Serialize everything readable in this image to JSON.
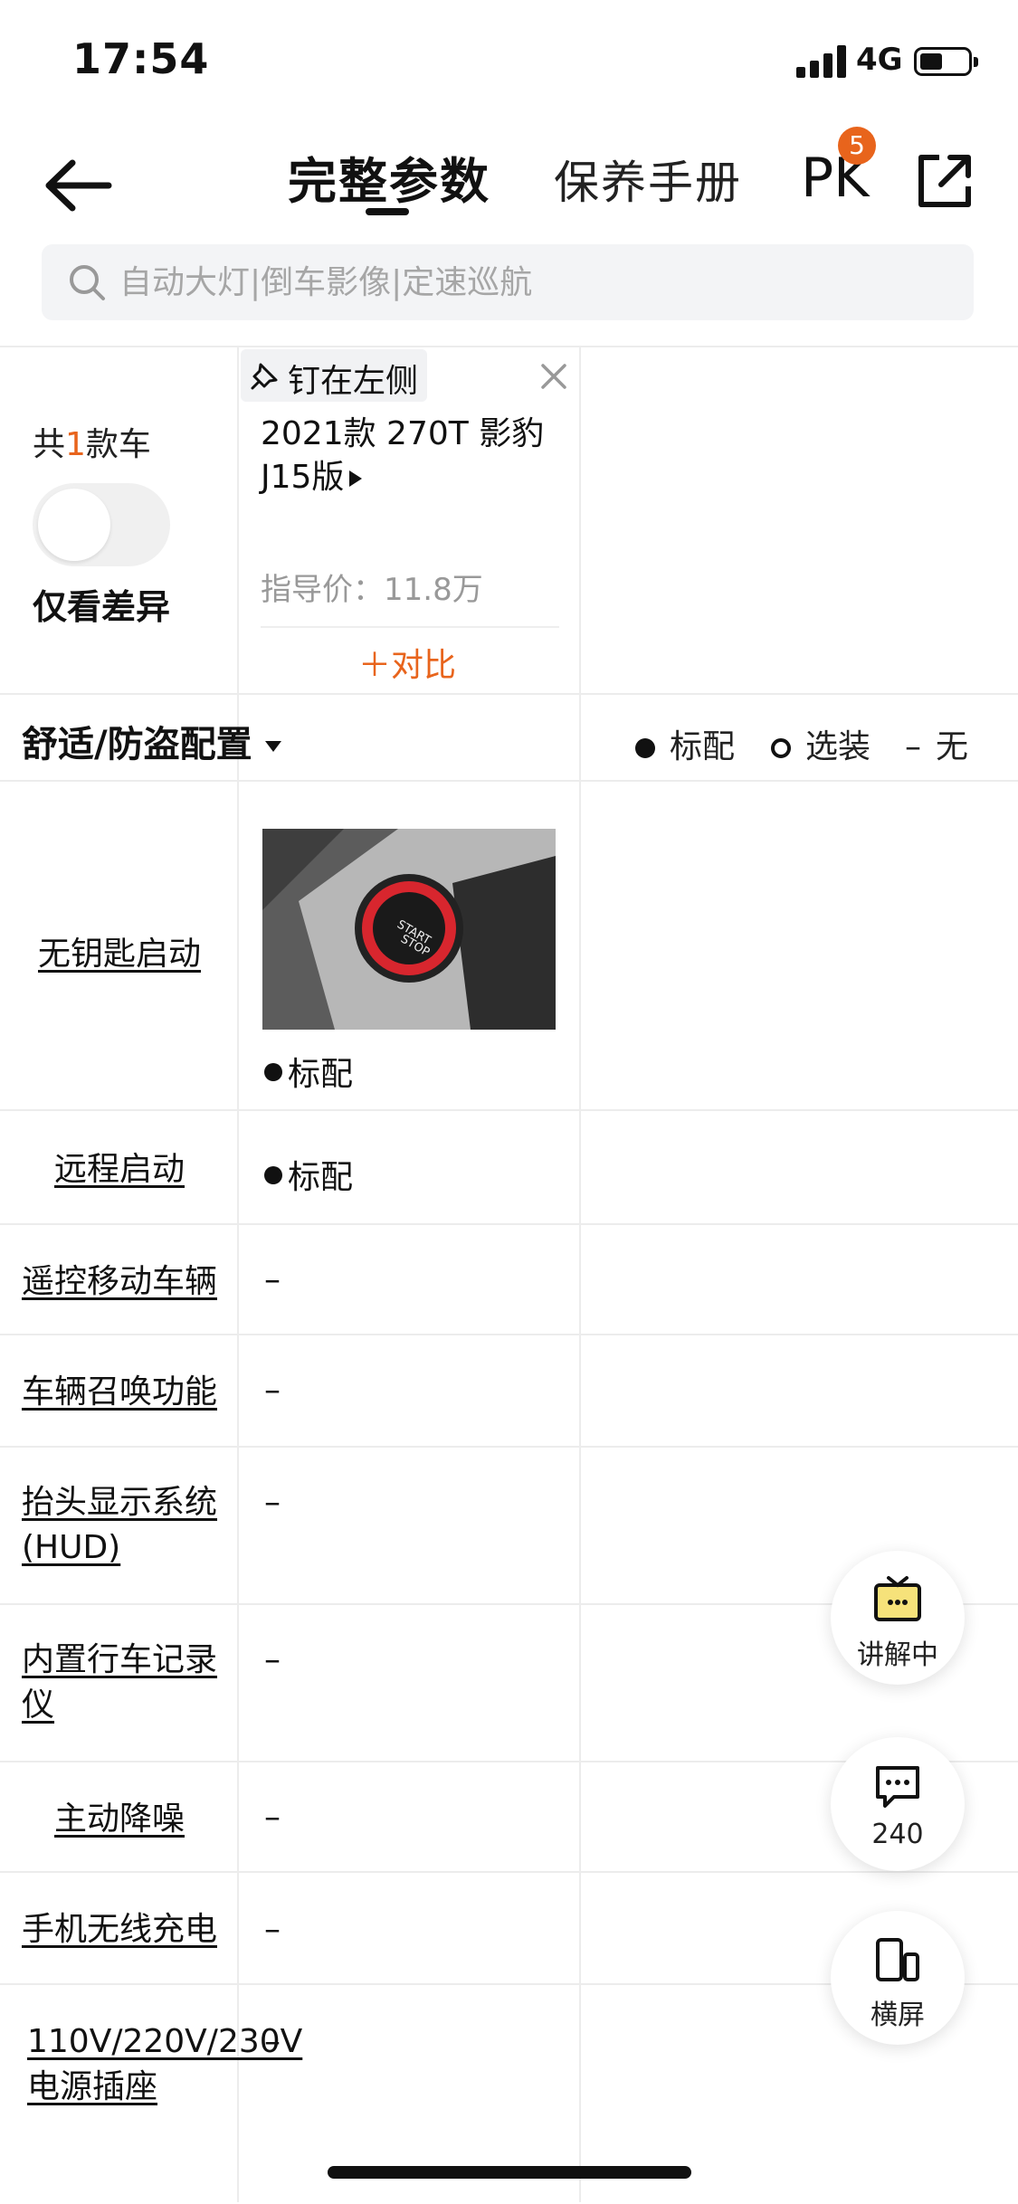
{
  "status_bar": {
    "time": "17:54",
    "network": "4G"
  },
  "nav": {
    "tab_active": "完整参数",
    "tab_secondary": "保养手册",
    "pk_label": "PK",
    "pk_badge": "5"
  },
  "search": {
    "placeholder": "自动大灯|倒车影像|定速巡航"
  },
  "compare_header": {
    "count_prefix": "共",
    "count_num": "1",
    "count_suffix": "款车",
    "diff_label": "仅看差异",
    "diff_toggle_on": false,
    "pin_label": "钉在左侧",
    "car_name": "2021款 270T 影豹J15版",
    "price": "指导价：11.8万",
    "compare_label": "＋对比"
  },
  "section": {
    "title": "舒适/防盗配置",
    "legend": {
      "standard": "标配",
      "optional": "选装",
      "none": "无",
      "none_symbol": "–"
    }
  },
  "rows": [
    {
      "label": "无钥匙启动",
      "value": "标配"
    },
    {
      "label": "远程启动",
      "value": "标配"
    },
    {
      "label": "遥控移动车辆",
      "value": "–"
    },
    {
      "label": "车辆召唤功能",
      "value": "–"
    },
    {
      "label": "抬头显示系统(HUD)",
      "value": "–"
    },
    {
      "label": "内置行车记录仪",
      "value": "–"
    },
    {
      "label": "主动降噪",
      "value": "–"
    },
    {
      "label": "手机无线充电",
      "value": "–"
    },
    {
      "label": "110V/220V/230V电源插座",
      "value": "–"
    }
  ],
  "floating": {
    "explain_label": "讲解中",
    "comment_count": "240",
    "landscape_label": "横屏"
  },
  "colors": {
    "accent": "#e8641c"
  }
}
